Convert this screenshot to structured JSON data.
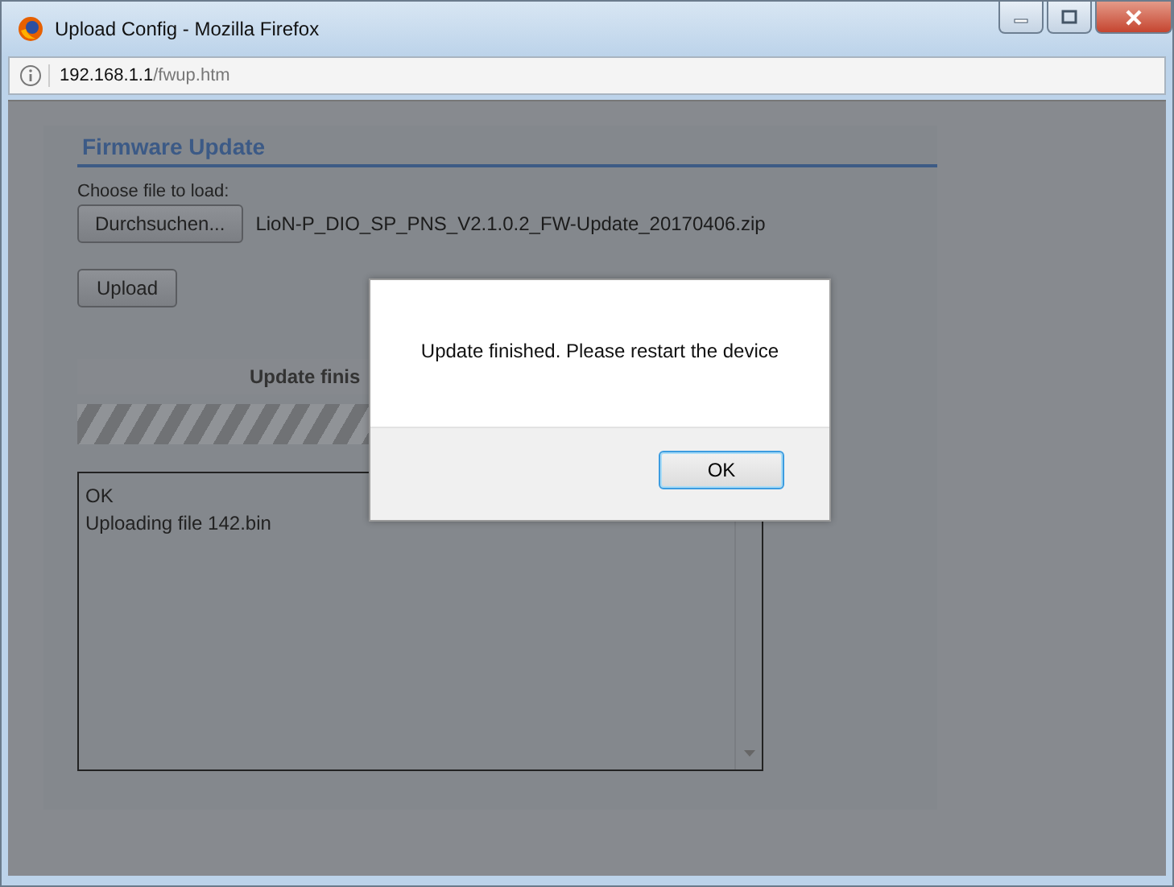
{
  "window": {
    "title": "Upload Config - Mozilla Firefox"
  },
  "address_bar": {
    "host": "192.168.1.1",
    "path": "/fwup.htm"
  },
  "panel": {
    "heading": "Firmware Update",
    "file_label": "Choose file to load:",
    "browse_button": "Durchsuchen...",
    "file_name": "LioN-P_DIO_SP_PNS_V2.1.0.2_FW-Update_20170406.zip",
    "upload_button": "Upload",
    "status_text": "Update finis",
    "progress": {
      "level": 1
    },
    "log_lines": [
      "OK",
      "Uploading file 142.bin"
    ]
  },
  "dialog": {
    "message": "Update finished. Please restart the device",
    "button": "OK"
  }
}
